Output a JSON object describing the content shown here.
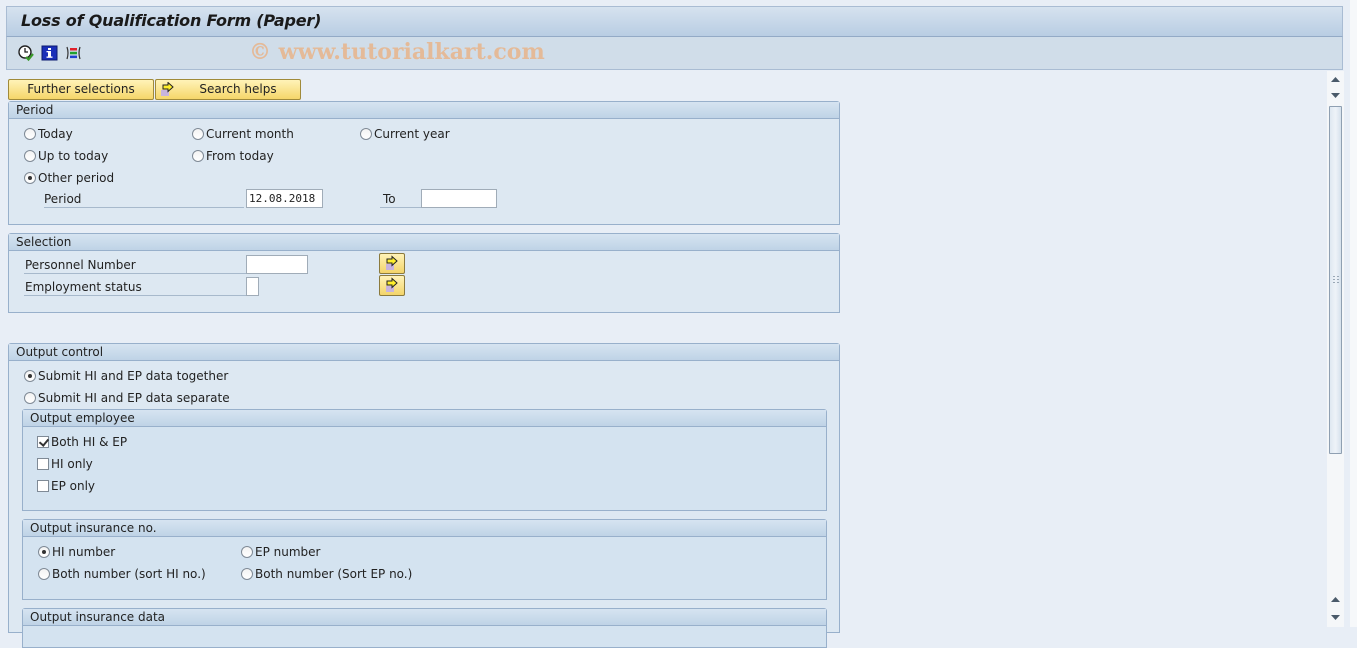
{
  "window": {
    "title": "Loss of Qualification Form (Paper)"
  },
  "toolbar": {
    "icons": [
      {
        "name": "execute-clock-icon",
        "tooltip": ""
      },
      {
        "name": "information-icon"
      },
      {
        "name": "selection-screen-icon"
      }
    ],
    "watermark": "© www.tutorialkart.com"
  },
  "buttons": {
    "further_selections": "Further selections",
    "search_helps": "Search helps"
  },
  "period": {
    "title": "Period",
    "options": [
      {
        "label": "Today",
        "selected": false
      },
      {
        "label": "Current month",
        "selected": false
      },
      {
        "label": "Current year",
        "selected": false
      },
      {
        "label": "Up to today",
        "selected": false
      },
      {
        "label": "From today",
        "selected": false
      },
      {
        "label": "Other period",
        "selected": true
      }
    ],
    "period_label": "Period",
    "period_from": "12.08.2018",
    "to_label": "To",
    "period_to": ""
  },
  "selection": {
    "title": "Selection",
    "personnel_number_label": "Personnel Number",
    "personnel_number_value": "",
    "employment_status_label": "Employment status",
    "employment_status_value": ""
  },
  "output_control": {
    "title": "Output control",
    "options": [
      {
        "label": "Submit HI and EP data together",
        "selected": true
      },
      {
        "label": "Submit HI and EP data separate",
        "selected": false
      }
    ],
    "output_employee": {
      "title": "Output employee",
      "checkboxes": [
        {
          "label": "Both HI & EP",
          "checked": true
        },
        {
          "label": "HI only",
          "checked": false
        },
        {
          "label": "EP only",
          "checked": false
        }
      ]
    },
    "output_insurance_no": {
      "title": "Output insurance no.",
      "options": [
        {
          "label": "HI number",
          "selected": true
        },
        {
          "label": "EP number",
          "selected": false
        },
        {
          "label": "Both number (sort HI no.)",
          "selected": false
        },
        {
          "label": "Both number (Sort EP no.)",
          "selected": false
        }
      ]
    },
    "output_insurance_data": {
      "title": "Output insurance data"
    }
  }
}
